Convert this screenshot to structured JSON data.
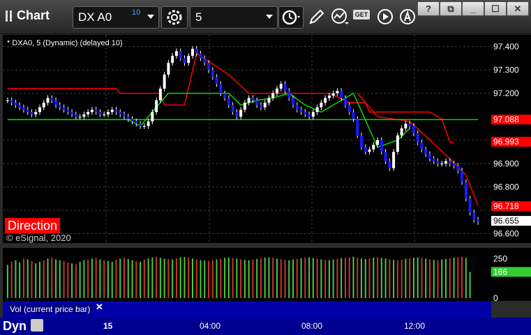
{
  "toolbar": {
    "chart_label": "Chart",
    "symbol": "DX A0",
    "delay_badge": "10",
    "interval": "5",
    "get_badge": "GET",
    "icons": [
      "gear-icon",
      "clock-icon",
      "pencil-icon",
      "study-icon",
      "get-data-icon",
      "play-icon",
      "cursor-icon"
    ],
    "window_buttons": [
      "?",
      "⧉",
      "_",
      "☐",
      "✕"
    ]
  },
  "colors": {
    "up_candle": "#ffffff",
    "down_candle": "#1a1aff",
    "trend_red": "#ff0000",
    "trend_green": "#00dd00",
    "vol_up": "#44cc44",
    "vol_down": "#cc3333"
  },
  "chart_title": "* DXA0, 5 (Dynamic) (delayed 10)",
  "direction_label": "Direction",
  "copyright": "© eSignal, 2020",
  "volume": {
    "title": "Vol (current price bar)",
    "close_symbol": "✕",
    "axis_ticks": [
      "250",
      "0"
    ],
    "current_value": "166"
  },
  "time_axis": {
    "mode": "Dyn",
    "labels": [
      {
        "text": "15",
        "bold": true
      },
      {
        "text": "04:00",
        "bold": false
      },
      {
        "text": "08:00",
        "bold": false
      },
      {
        "text": "12:00",
        "bold": false
      }
    ]
  },
  "chart_data": {
    "type": "candlestick",
    "ylim": [
      96.56,
      97.45
    ],
    "y_ticks": [
      97.4,
      97.3,
      97.2,
      96.9,
      96.8,
      96.6
    ],
    "y_tick_labels": [
      "97.400",
      "97.300",
      "97.200",
      "96.900",
      "96.800",
      "96.600"
    ],
    "price_markers": [
      {
        "label": "97.088",
        "value": 97.088,
        "color": "#ff0000"
      },
      {
        "label": "96.993",
        "value": 96.993,
        "color": "#ff0000"
      },
      {
        "label": "96.718",
        "value": 96.718,
        "color": "#ff0000"
      },
      {
        "label": "96.655",
        "value": 96.655,
        "color": "#ffffff"
      }
    ],
    "close_series": [
      97.17,
      97.16,
      97.15,
      97.14,
      97.13,
      97.12,
      97.11,
      97.12,
      97.14,
      97.16,
      97.18,
      97.17,
      97.15,
      97.14,
      97.13,
      97.12,
      97.11,
      97.1,
      97.1,
      97.11,
      97.12,
      97.13,
      97.12,
      97.11,
      97.11,
      97.12,
      97.13,
      97.12,
      97.11,
      97.1,
      97.09,
      97.08,
      97.07,
      97.06,
      97.06,
      97.08,
      97.12,
      97.17,
      97.22,
      97.28,
      97.33,
      97.36,
      97.38,
      97.35,
      97.33,
      97.36,
      97.39,
      97.37,
      97.35,
      97.33,
      97.3,
      97.27,
      97.24,
      97.2,
      97.18,
      97.15,
      97.12,
      97.1,
      97.13,
      97.16,
      97.18,
      97.17,
      97.15,
      97.14,
      97.16,
      97.18,
      97.2,
      97.22,
      97.24,
      97.21,
      97.18,
      97.15,
      97.13,
      97.12,
      97.11,
      97.1,
      97.12,
      97.14,
      97.16,
      97.18,
      97.19,
      97.2,
      97.21,
      97.18,
      97.15,
      97.12,
      97.09,
      97.02,
      96.97,
      96.95,
      96.96,
      96.98,
      97.0,
      96.95,
      96.91,
      96.88,
      96.95,
      97.02,
      97.05,
      97.07,
      97.06,
      97.03,
      96.99,
      96.96,
      96.94,
      96.92,
      96.91,
      96.9,
      96.9,
      96.91,
      96.9,
      96.89,
      96.87,
      96.82,
      96.75,
      96.69,
      96.66,
      96.65
    ],
    "red_line": [
      {
        "i": 0,
        "v": 97.22
      },
      {
        "i": 27,
        "v": 97.22
      },
      {
        "i": 28,
        "v": 97.2
      },
      {
        "i": 38,
        "v": 97.2
      },
      {
        "i": 39,
        "v": 97.15
      },
      {
        "i": 44,
        "v": 97.15
      },
      {
        "i": 47,
        "v": 97.37
      },
      {
        "i": 55,
        "v": 97.28
      },
      {
        "i": 60,
        "v": 97.2
      },
      {
        "i": 80,
        "v": 97.2
      },
      {
        "i": 85,
        "v": 97.16
      },
      {
        "i": 89,
        "v": 97.16
      },
      {
        "i": 90,
        "v": 97.12
      },
      {
        "i": 105,
        "v": 97.12
      },
      {
        "i": 108,
        "v": 97.09
      },
      {
        "i": 110,
        "v": 96.99
      },
      {
        "i": 111,
        "v": 96.99
      }
    ],
    "red_trail": [
      {
        "i": 87,
        "v": 97.2
      },
      {
        "i": 92,
        "v": 97.1
      },
      {
        "i": 100,
        "v": 97.08
      },
      {
        "i": 105,
        "v": 97.0
      },
      {
        "i": 110,
        "v": 96.92
      },
      {
        "i": 114,
        "v": 96.85
      },
      {
        "i": 117,
        "v": 96.72
      }
    ],
    "green_line": [
      {
        "i": 0,
        "v": 97.088
      },
      {
        "i": 30,
        "v": 97.088
      },
      {
        "i": 33,
        "v": 97.06
      },
      {
        "i": 36,
        "v": 97.12
      },
      {
        "i": 40,
        "v": 97.2
      },
      {
        "i": 45,
        "v": 97.2
      },
      {
        "i": 55,
        "v": 97.2
      },
      {
        "i": 58,
        "v": 97.15
      },
      {
        "i": 62,
        "v": 97.17
      },
      {
        "i": 66,
        "v": 97.18
      },
      {
        "i": 70,
        "v": 97.2
      },
      {
        "i": 74,
        "v": 97.15
      },
      {
        "i": 78,
        "v": 97.12
      },
      {
        "i": 82,
        "v": 97.16
      },
      {
        "i": 86,
        "v": 97.2
      },
      {
        "i": 92,
        "v": 96.97
      },
      {
        "i": 97,
        "v": 97.0
      },
      {
        "i": 100,
        "v": 97.05
      }
    ],
    "green_flat": {
      "value": 97.088,
      "from": 0,
      "to": 117
    },
    "volume_ylim": [
      0,
      300
    ],
    "volume_values": [
      210,
      230,
      240,
      225,
      250,
      245,
      235,
      220,
      230,
      240,
      250,
      255,
      245,
      240,
      235,
      225,
      220,
      215,
      230,
      240,
      245,
      250,
      255,
      245,
      240,
      235,
      230,
      245,
      250,
      255,
      248,
      240,
      235,
      230,
      245,
      252,
      258,
      262,
      255,
      250,
      248,
      245,
      252,
      258,
      260,
      256,
      250,
      246,
      240,
      238,
      235,
      240,
      245,
      250,
      255,
      258,
      254,
      250,
      246,
      242,
      240,
      244,
      248,
      252,
      256,
      258,
      254,
      250,
      246,
      242,
      240,
      244,
      248,
      252,
      256,
      258,
      254,
      250,
      246,
      242,
      240,
      244,
      248,
      252,
      256,
      258,
      262,
      255,
      250,
      248,
      252,
      256,
      258,
      254,
      250,
      246,
      242,
      240,
      244,
      248,
      252,
      256,
      258,
      254,
      250,
      246,
      242,
      240,
      244,
      248,
      252,
      256,
      258,
      262,
      255,
      166
    ],
    "volume_up": [
      true,
      false,
      true,
      true,
      false,
      true,
      false,
      true,
      true,
      false,
      true,
      false,
      true,
      true,
      false,
      false,
      true,
      false,
      true,
      true,
      false,
      true,
      false,
      true,
      false,
      true,
      true,
      false,
      true,
      false,
      true,
      true,
      false,
      true,
      false,
      true,
      true,
      false,
      true,
      true,
      false,
      true,
      false,
      true,
      true,
      false,
      true,
      false,
      true,
      true,
      false,
      false,
      true,
      false,
      true,
      true,
      false,
      true,
      false,
      true,
      true,
      false,
      true,
      false,
      true,
      true,
      false,
      true,
      false,
      false,
      true,
      true,
      false,
      true,
      false,
      true,
      true,
      false,
      true,
      false,
      true,
      true,
      false,
      true,
      false,
      false,
      true,
      false,
      true,
      true,
      false,
      true,
      false,
      true,
      true,
      false,
      true,
      false,
      false,
      true,
      false,
      true,
      true,
      false,
      true,
      false,
      true,
      false,
      true,
      true,
      false,
      true,
      false,
      false,
      true,
      true
    ]
  }
}
